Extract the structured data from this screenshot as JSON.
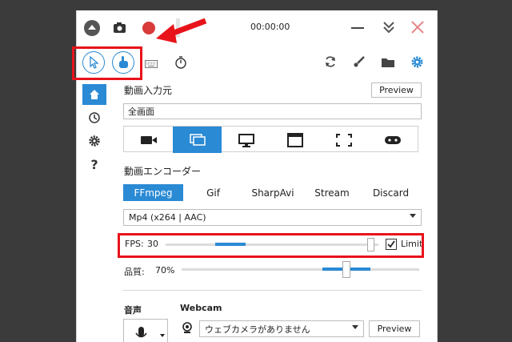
{
  "titlebar": {
    "timer": "00:00:00"
  },
  "toolbar": {
    "cursor_tool": "cursor-icon",
    "hand_tool": "hand-icon",
    "keyboard_tool": "keyboard-icon",
    "timer_tool": "stopwatch-icon"
  },
  "sidebar": {
    "help_label": "?"
  },
  "source": {
    "section_label": "動画入力元",
    "preview_button": "Preview",
    "input_value": "全画面",
    "tabs": [
      "camera",
      "screen",
      "monitor",
      "window",
      "region",
      "game"
    ],
    "selected_tab": 1
  },
  "encoder": {
    "section_label": "動画エンコーダー",
    "tabs": [
      "FFmpeg",
      "Gif",
      "SharpAvi",
      "Stream",
      "Discard"
    ],
    "selected_tab": 0,
    "format_value": "Mp4 (x264 | AAC)"
  },
  "fps": {
    "label": "FPS:",
    "value": "30",
    "limit_label": "Limit",
    "limit_checked": true,
    "level": 0.98
  },
  "quality": {
    "label": "品質:",
    "value": "70%",
    "level": 0.7
  },
  "audio": {
    "section_label": "音声"
  },
  "webcam": {
    "section_label": "Webcam",
    "select_value": "ウェブカメラがありません",
    "preview_button": "Preview"
  },
  "colors": {
    "accent": "#2a8ad4",
    "record": "#d93a3a",
    "highlight": "#e8131a",
    "window_bg": "#3b3b3b"
  }
}
